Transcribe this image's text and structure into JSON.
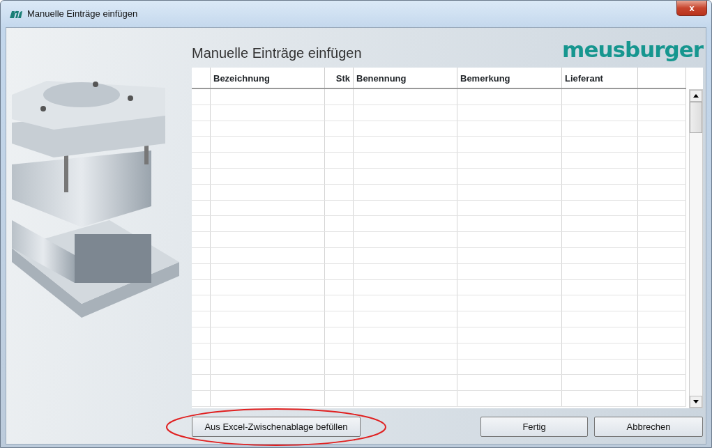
{
  "window": {
    "title": "Manuelle Einträge einfügen",
    "close_label": "x"
  },
  "heading": "Manuelle Einträge einfügen",
  "logo": "meusburger",
  "table": {
    "columns": [
      {
        "kind": "blank"
      },
      {
        "kind": "text",
        "label": "Bezeichnung"
      },
      {
        "kind": "number",
        "label": "Stk"
      },
      {
        "kind": "text",
        "label": "Benennung"
      },
      {
        "kind": "text",
        "label": "Bemerkung"
      },
      {
        "kind": "text",
        "label": "Lieferant"
      },
      {
        "kind": "blank"
      }
    ]
  },
  "buttons": [
    {
      "label": "Aus Excel-Zwischenablage befüllen",
      "highlighted": true
    },
    {
      "label": "Fertig",
      "highlighted": false
    },
    {
      "label": "Abbrechen",
      "highlighted": false
    }
  ]
}
